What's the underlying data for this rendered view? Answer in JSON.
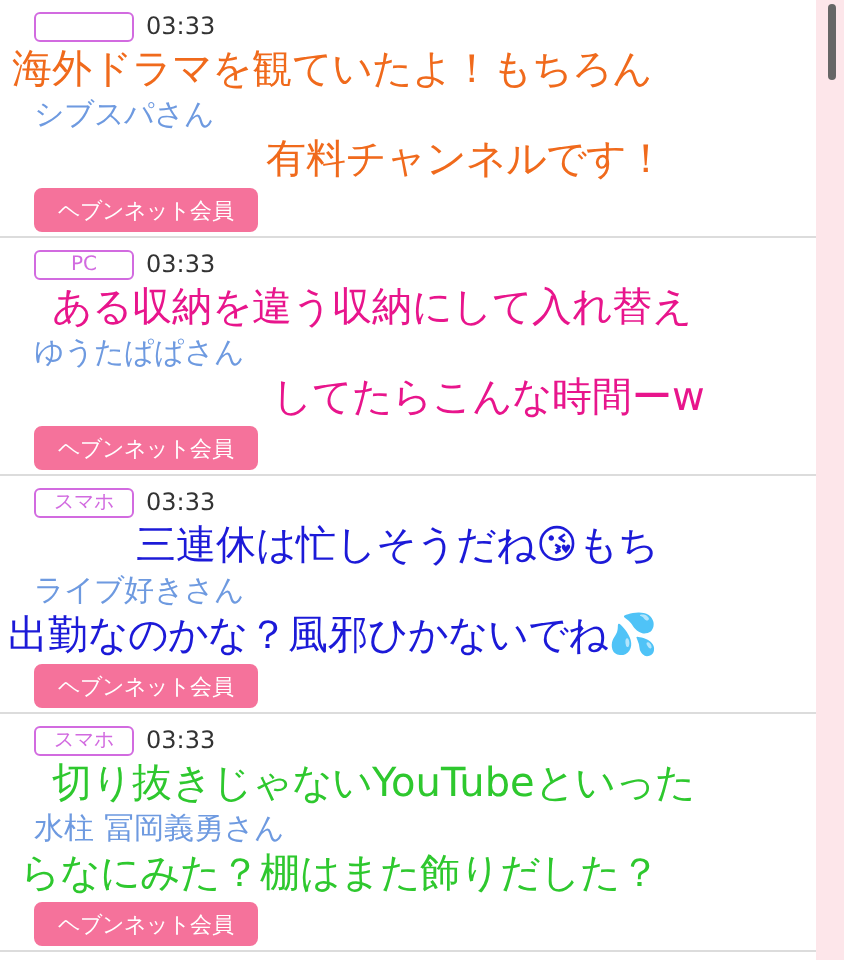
{
  "comments": [
    {
      "time": "03:33",
      "name": "シブスパさん",
      "badge": "ヘブンネット会員",
      "message": {
        "lines": [
          "海外ドラマを観ていたよ！もちろん",
          "有料チャンネルです！"
        ],
        "color": "#f06a1c"
      }
    },
    {
      "device": "PC",
      "time": "03:33",
      "name": "ゆうたぱぱさん",
      "badge": "ヘブンネット会員",
      "message": {
        "lines": [
          "ある収納を違う収納にして入れ替え",
          "してたらこんな時間ーw"
        ],
        "color": "#e8158c"
      }
    },
    {
      "device": "スマホ",
      "time": "03:33",
      "name": "ライブ好きさん",
      "badge": "ヘブンネット会員",
      "message": {
        "lines": [
          "三連休は忙しそうだね😘もち",
          "出勤なのかな？風邪ひかないでね💦"
        ],
        "color": "#1c1ad8"
      }
    },
    {
      "device": "スマホ",
      "time": "03:33",
      "name": "水柱 冨岡義勇さん",
      "badge": "ヘブンネット会員",
      "message": {
        "lines": [
          "切り抜きじゃないYouTubeといった",
          "らなにみた？棚はまた飾りだした？"
        ],
        "color": "#2ec82e"
      }
    }
  ]
}
